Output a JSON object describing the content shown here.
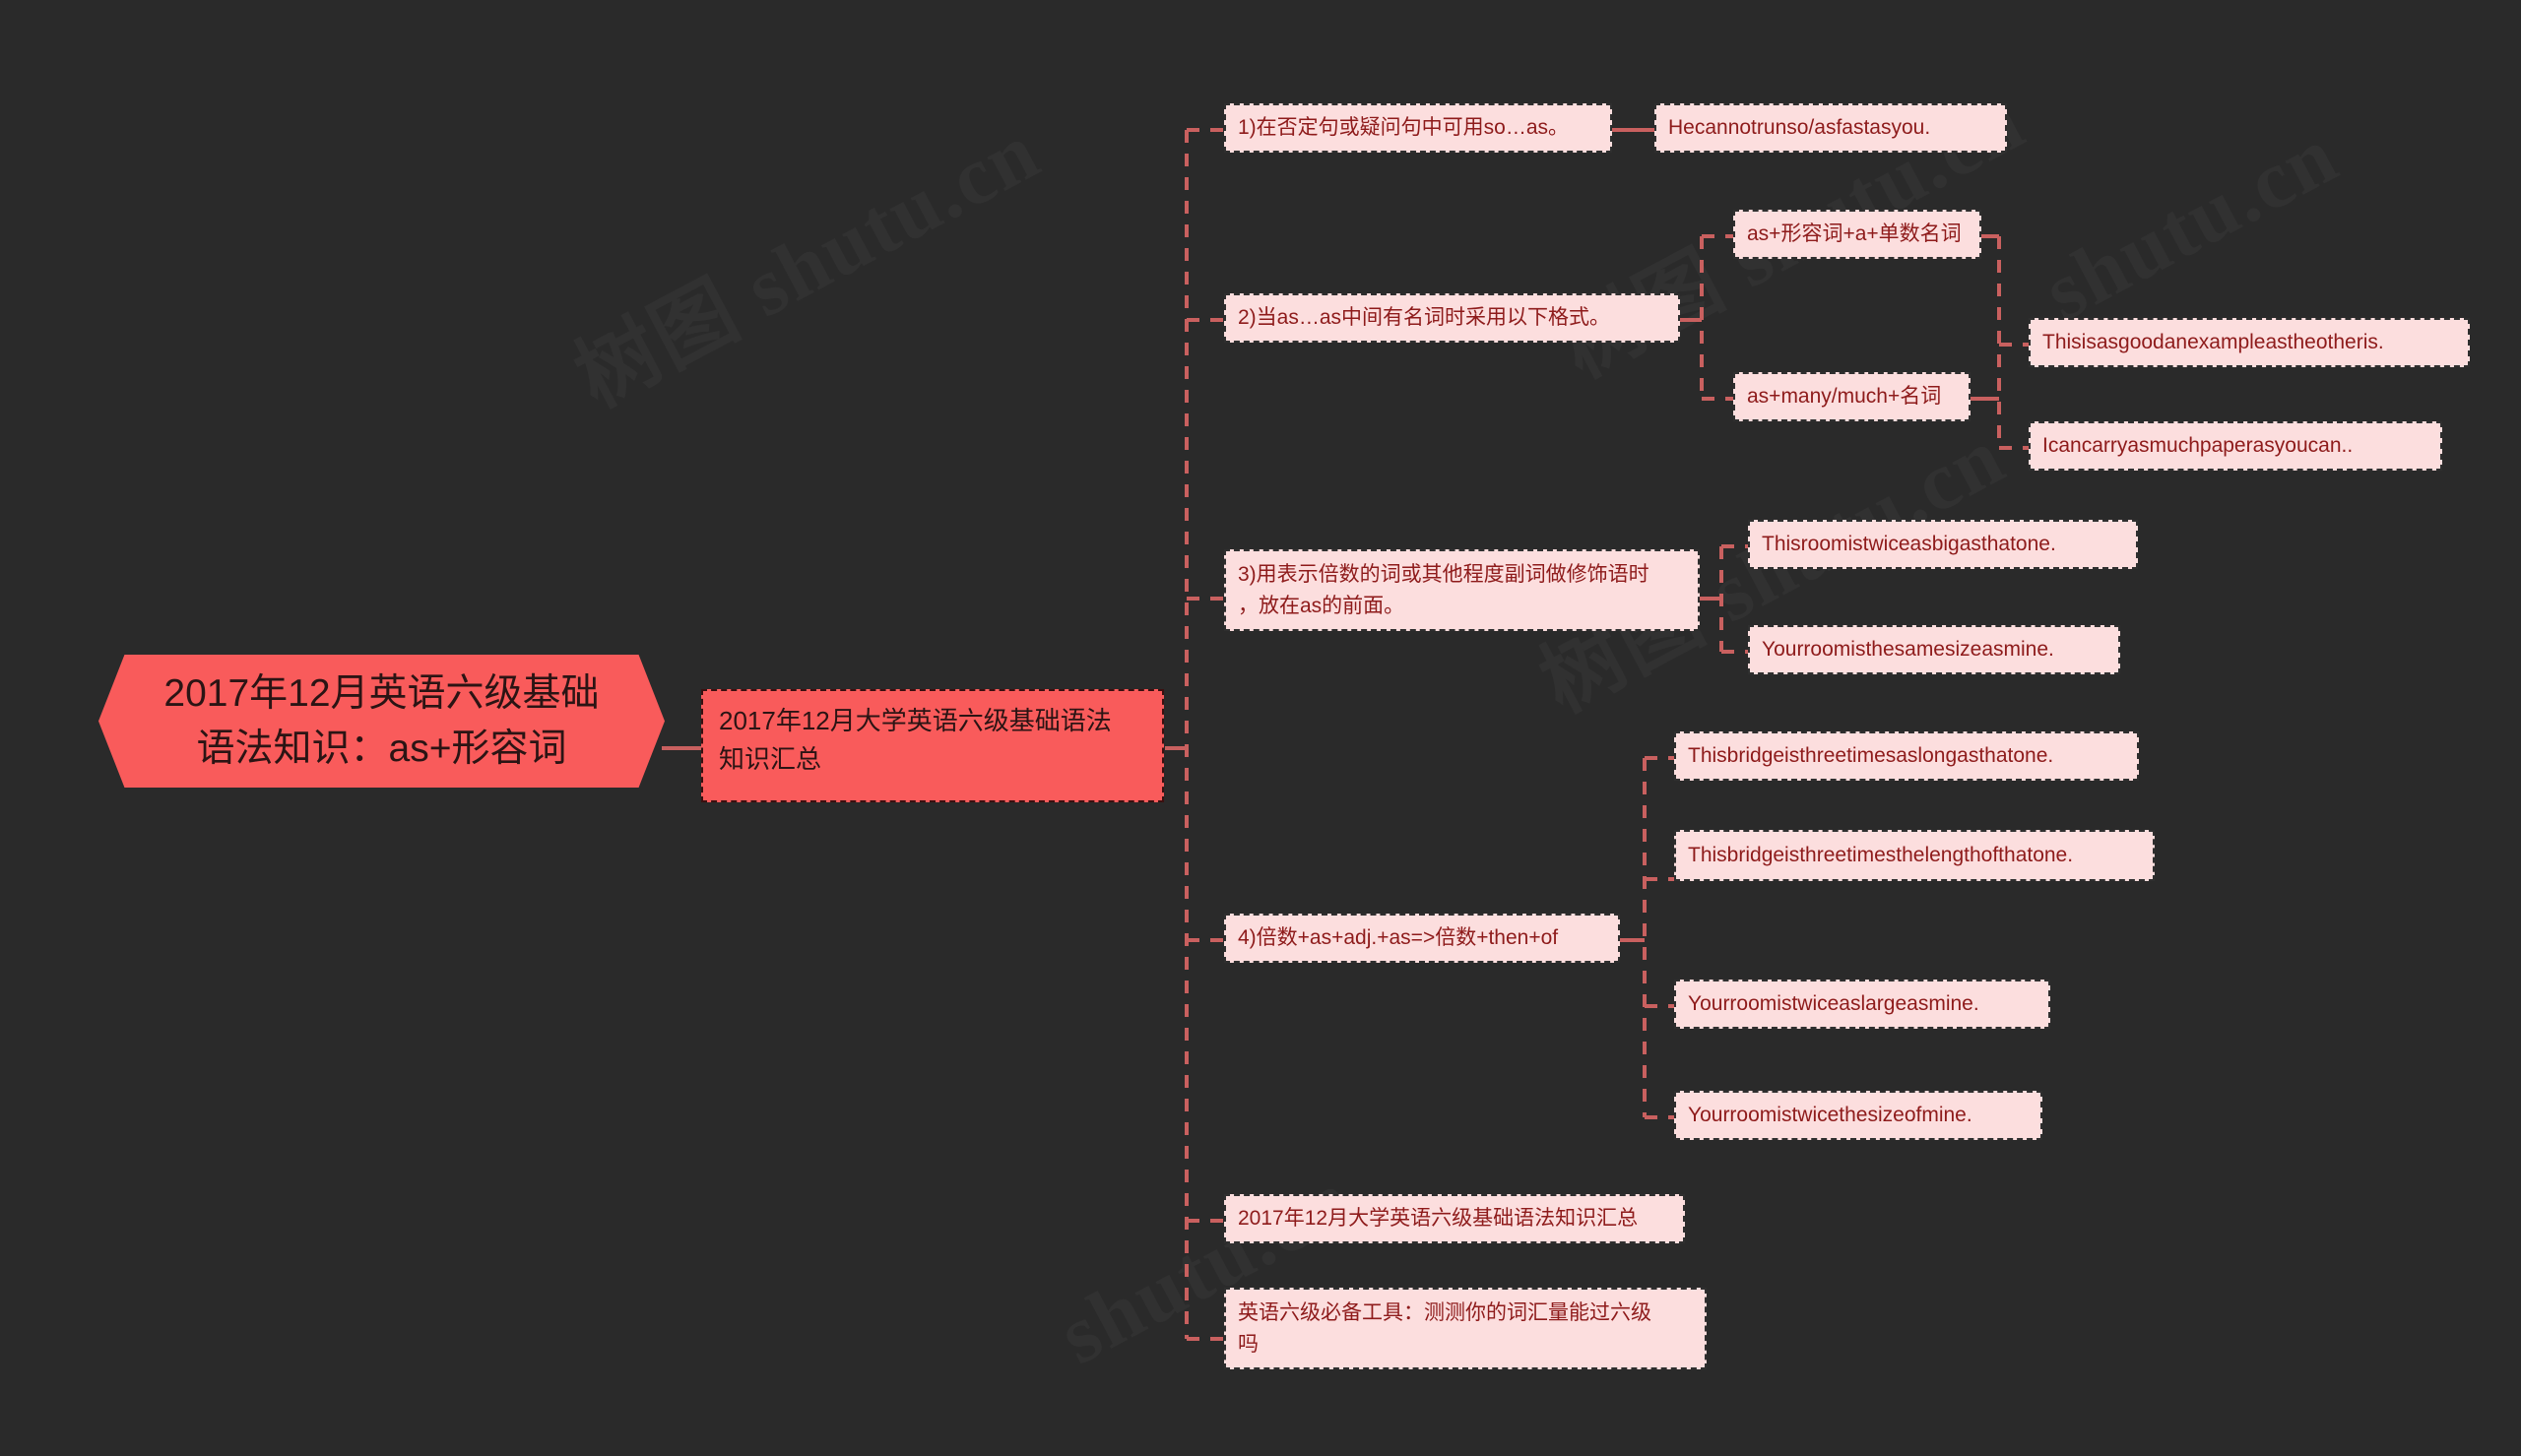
{
  "meta": {
    "background_color": "#2a2a2a",
    "root_fill": "#f95b5b",
    "leaf_fill": "#fcdede",
    "leaf_text_color": "#8e1b1b",
    "connector_color": "#c9605f"
  },
  "watermarks": [
    "树图 shutu.cn",
    "树图 shutu.cn",
    "树图 shutu.cn",
    "shutu.cn",
    "shutu.cn"
  ],
  "mindmap": {
    "root": {
      "label": "2017年12月英语六级基础\n语法知识：as+形容词"
    },
    "topic": {
      "label": "2017年12月大学英语六级基础语法\n知识汇总"
    },
    "branches": [
      {
        "label": "1)在否定句或疑问句中可用so…as。",
        "children": [
          {
            "label": "Hecannotrunso/asfastasyou."
          }
        ]
      },
      {
        "label": "2)当as…as中间有名词时采用以下格式。",
        "children": [
          {
            "label": "as+形容词+a+单数名词",
            "children": [
              {
                "label": "Thisisasgoodanexampleastheotheris."
              }
            ]
          },
          {
            "label": "as+many/much+名词",
            "children": [
              {
                "label": "Icancarryasmuchpaperasyoucan.."
              }
            ]
          }
        ]
      },
      {
        "label": "3)用表示倍数的词或其他程度副词做修饰语时\n，放在as的前面。",
        "children": [
          {
            "label": "Thisroomistwiceasbigasthatone."
          },
          {
            "label": "Yourroomisthesamesizeasmine."
          }
        ]
      },
      {
        "label": "4)倍数+as+adj.+as=>倍数+then+of",
        "children": [
          {
            "label": "Thisbridgeisthreetimesaslongasthatone."
          },
          {
            "label": "Thisbridgeisthreetimesthelengthofthatone."
          },
          {
            "label": "Yourroomistwiceaslargeasmine."
          },
          {
            "label": "Yourroomistwicethesizeofmine."
          }
        ]
      },
      {
        "label": "2017年12月大学英语六级基础语法知识汇总",
        "children": []
      },
      {
        "label": "英语六级必备工具：测测你的词汇量能过六级\n吗",
        "children": []
      }
    ]
  }
}
